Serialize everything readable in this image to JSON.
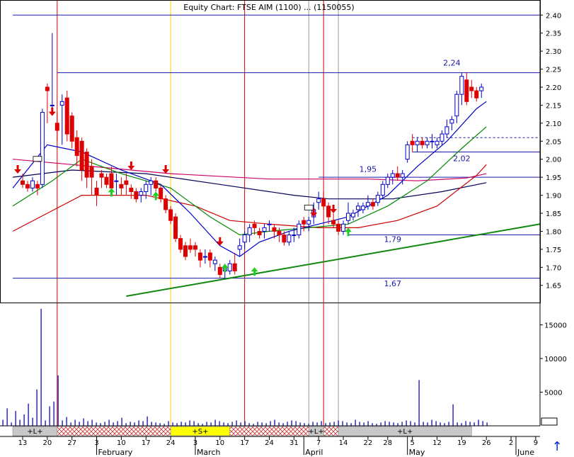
{
  "header": {
    "title": "Equity Chart: FTSE AIM (1100) ... (1150055)"
  },
  "chart_data": {
    "type": "candlestick",
    "price_axis": {
      "ticks": [
        "2.40",
        "2.35",
        "2.30",
        "2.25",
        "2.20",
        "2.15",
        "2.10",
        "2.05",
        "2.00",
        "1.95",
        "1.90",
        "1.85",
        "1.80",
        "1.75",
        "1.70",
        "1.65"
      ],
      "ylim": [
        1.62,
        2.43
      ]
    },
    "volume_axis": {
      "ticks": [
        "15000",
        "10000",
        "5000"
      ],
      "ylim": [
        0,
        18000
      ]
    },
    "date_labels": [
      {
        "label": "13",
        "pos": 0
      },
      {
        "label": "20",
        "pos": 5
      },
      {
        "label": "27",
        "pos": 10
      },
      {
        "label": "3",
        "pos": 15
      },
      {
        "label": "10",
        "pos": 20
      },
      {
        "label": "17",
        "pos": 25
      },
      {
        "label": "24",
        "pos": 30
      },
      {
        "label": "3",
        "pos": 35
      },
      {
        "label": "10",
        "pos": 40
      },
      {
        "label": "17",
        "pos": 45
      },
      {
        "label": "24",
        "pos": 50
      },
      {
        "label": "31",
        "pos": 55
      },
      {
        "label": "7",
        "pos": 60
      },
      {
        "label": "14",
        "pos": 65
      },
      {
        "label": "22",
        "pos": 70
      },
      {
        "label": "28",
        "pos": 74
      },
      {
        "label": "5",
        "pos": 79
      },
      {
        "label": "12",
        "pos": 84
      },
      {
        "label": "19",
        "pos": 89
      },
      {
        "label": "26",
        "pos": 94
      },
      {
        "label": "2",
        "pos": 99
      },
      {
        "label": "9",
        "pos": 104
      }
    ],
    "month_labels": [
      {
        "label": "February",
        "pos": 15
      },
      {
        "label": "March",
        "pos": 35
      },
      {
        "label": "April",
        "pos": 57
      },
      {
        "label": "May",
        "pos": 78
      },
      {
        "label": "June",
        "pos": 100
      }
    ],
    "annotations": [
      {
        "text": "2,24",
        "price": 2.26,
        "pos": 87
      },
      {
        "text": "2,02",
        "price": 1.995,
        "pos": 89
      },
      {
        "text": "1,95",
        "price": 1.965,
        "pos": 70
      },
      {
        "text": "1,79",
        "price": 1.77,
        "pos": 75
      },
      {
        "text": "1,67",
        "price": 1.648,
        "pos": 75
      }
    ],
    "horizontal_levels": [
      {
        "price": 2.4,
        "from": -2,
        "to": 107
      },
      {
        "price": 2.24,
        "from": 7,
        "to": 107
      },
      {
        "price": 2.02,
        "from": 79,
        "to": 107
      },
      {
        "price": 1.95,
        "from": 60,
        "to": 107
      },
      {
        "price": 1.79,
        "from": 66,
        "to": 107
      },
      {
        "price": 1.67,
        "from": -2,
        "to": 107
      }
    ],
    "dashed_levels": [
      {
        "price": 2.06,
        "from": 79,
        "to": 107
      }
    ],
    "trendline": {
      "from": {
        "pos": 21,
        "price": 1.62
      },
      "to": {
        "pos": 108,
        "price": 1.82
      }
    },
    "vertical_markers": [
      {
        "pos": 7,
        "color": "#cc0000"
      },
      {
        "pos": 30,
        "color": "#ffd200"
      },
      {
        "pos": 45,
        "color": "#cc0000"
      },
      {
        "pos": 58,
        "color": "#999999"
      },
      {
        "pos": 61,
        "color": "#cc0000"
      },
      {
        "pos": 64,
        "color": "#999999"
      }
    ],
    "signal_bar": [
      {
        "label": "+L+",
        "from": -2,
        "to": 7,
        "style": "grey"
      },
      {
        "label": "",
        "from": 7,
        "to": 30,
        "style": "hatch"
      },
      {
        "label": "+S+",
        "from": 30,
        "to": 42,
        "style": "yellow"
      },
      {
        "label": "",
        "from": 42,
        "to": 58,
        "style": "hatch"
      },
      {
        "label": "+L+",
        "from": 58,
        "to": 61,
        "style": "grey"
      },
      {
        "label": "",
        "from": 61,
        "to": 64,
        "style": "hatch"
      },
      {
        "label": "+L+",
        "from": 64,
        "to": 91,
        "style": "grey"
      }
    ],
    "candles": [
      [
        1.94,
        1.96,
        1.92,
        1.93
      ],
      [
        1.93,
        1.94,
        1.91,
        1.92
      ],
      [
        1.92,
        1.95,
        1.91,
        1.94
      ],
      [
        1.93,
        1.94,
        1.9,
        1.92
      ],
      [
        1.93,
        2.14,
        1.92,
        2.13
      ],
      [
        2.2,
        2.21,
        2.1,
        2.19
      ],
      [
        2.15,
        2.35,
        2.13,
        2.15
      ],
      [
        2.1,
        2.13,
        2.05,
        2.08
      ],
      [
        2.15,
        2.18,
        2.04,
        2.16
      ],
      [
        2.17,
        2.19,
        2.05,
        2.07
      ],
      [
        2.12,
        2.13,
        2.03,
        2.05
      ],
      [
        2.06,
        2.08,
        1.98,
        2.01
      ],
      [
        2.05,
        2.06,
        1.94,
        1.97
      ],
      [
        2.02,
        2.03,
        1.92,
        1.95
      ],
      [
        1.98,
        2.0,
        1.9,
        1.95
      ],
      [
        1.92,
        1.94,
        1.87,
        1.9
      ],
      [
        1.96,
        1.97,
        1.92,
        1.95
      ],
      [
        1.95,
        1.96,
        1.92,
        1.93
      ],
      [
        1.96,
        1.98,
        1.91,
        1.92
      ],
      [
        1.94,
        1.96,
        1.9,
        1.94
      ],
      [
        1.93,
        1.95,
        1.9,
        1.92
      ],
      [
        1.94,
        1.96,
        1.9,
        1.93
      ],
      [
        1.92,
        1.93,
        1.89,
        1.91
      ],
      [
        1.91,
        1.92,
        1.88,
        1.89
      ],
      [
        1.9,
        1.92,
        1.88,
        1.91
      ],
      [
        1.91,
        1.94,
        1.89,
        1.93
      ],
      [
        1.93,
        1.95,
        1.9,
        1.94
      ],
      [
        1.94,
        1.95,
        1.91,
        1.92
      ],
      [
        1.92,
        1.93,
        1.88,
        1.89
      ],
      [
        1.89,
        1.9,
        1.85,
        1.86
      ],
      [
        1.86,
        1.87,
        1.82,
        1.83
      ],
      [
        1.84,
        1.85,
        1.77,
        1.78
      ],
      [
        1.78,
        1.79,
        1.74,
        1.75
      ],
      [
        1.76,
        1.77,
        1.72,
        1.73
      ],
      [
        1.76,
        1.78,
        1.74,
        1.75
      ],
      [
        1.76,
        1.77,
        1.73,
        1.75
      ],
      [
        1.74,
        1.75,
        1.7,
        1.72
      ],
      [
        1.73,
        1.75,
        1.71,
        1.73
      ],
      [
        1.74,
        1.75,
        1.7,
        1.72
      ],
      [
        1.71,
        1.73,
        1.69,
        1.72
      ],
      [
        1.7,
        1.71,
        1.67,
        1.68
      ],
      [
        1.69,
        1.71,
        1.67,
        1.7
      ],
      [
        1.69,
        1.72,
        1.68,
        1.71
      ],
      [
        1.71,
        1.74,
        1.68,
        1.69
      ],
      [
        1.75,
        1.78,
        1.73,
        1.76
      ],
      [
        1.77,
        1.8,
        1.75,
        1.79
      ],
      [
        1.79,
        1.82,
        1.77,
        1.81
      ],
      [
        1.82,
        1.83,
        1.79,
        1.81
      ],
      [
        1.8,
        1.81,
        1.78,
        1.79
      ],
      [
        1.8,
        1.82,
        1.78,
        1.81
      ],
      [
        1.82,
        1.83,
        1.8,
        1.82
      ],
      [
        1.81,
        1.82,
        1.78,
        1.8
      ],
      [
        1.8,
        1.81,
        1.77,
        1.79
      ],
      [
        1.79,
        1.8,
        1.76,
        1.77
      ],
      [
        1.77,
        1.8,
        1.76,
        1.79
      ],
      [
        1.79,
        1.81,
        1.77,
        1.79
      ],
      [
        1.79,
        1.83,
        1.78,
        1.82
      ],
      [
        1.83,
        1.84,
        1.8,
        1.82
      ],
      [
        1.82,
        1.84,
        1.8,
        1.83
      ],
      [
        1.84,
        1.88,
        1.82,
        1.86
      ],
      [
        1.88,
        1.91,
        1.86,
        1.89
      ],
      [
        1.89,
        1.91,
        1.86,
        1.87
      ],
      [
        1.87,
        1.88,
        1.82,
        1.84
      ],
      [
        1.83,
        1.85,
        1.81,
        1.82
      ],
      [
        1.82,
        1.83,
        1.79,
        1.8
      ],
      [
        1.8,
        1.83,
        1.79,
        1.82
      ],
      [
        1.83,
        1.88,
        1.82,
        1.85
      ],
      [
        1.84,
        1.86,
        1.83,
        1.85
      ],
      [
        1.86,
        1.88,
        1.84,
        1.87
      ],
      [
        1.86,
        1.88,
        1.85,
        1.87
      ],
      [
        1.87,
        1.9,
        1.86,
        1.88
      ],
      [
        1.88,
        1.89,
        1.86,
        1.87
      ],
      [
        1.88,
        1.91,
        1.87,
        1.9
      ],
      [
        1.9,
        1.94,
        1.89,
        1.93
      ],
      [
        1.93,
        1.96,
        1.92,
        1.95
      ],
      [
        1.95,
        1.97,
        1.93,
        1.96
      ],
      [
        1.96,
        1.98,
        1.94,
        1.95
      ],
      [
        1.95,
        1.97,
        1.93,
        1.96
      ],
      [
        2.0,
        2.05,
        1.99,
        2.04
      ],
      [
        2.05,
        2.07,
        2.02,
        2.04
      ],
      [
        2.04,
        2.06,
        2.02,
        2.05
      ],
      [
        2.05,
        2.06,
        2.03,
        2.04
      ],
      [
        2.04,
        2.06,
        2.03,
        2.05
      ],
      [
        2.05,
        2.07,
        2.03,
        2.05
      ],
      [
        2.04,
        2.06,
        2.03,
        2.05
      ],
      [
        2.05,
        2.08,
        2.04,
        2.07
      ],
      [
        2.07,
        2.11,
        2.06,
        2.09
      ],
      [
        2.1,
        2.12,
        2.08,
        2.11
      ],
      [
        2.12,
        2.19,
        2.1,
        2.18
      ],
      [
        2.18,
        2.24,
        2.15,
        2.23
      ],
      [
        2.22,
        2.24,
        2.15,
        2.16
      ],
      [
        2.2,
        2.22,
        2.17,
        2.19
      ],
      [
        2.19,
        2.2,
        2.16,
        2.17
      ],
      [
        2.19,
        2.21,
        2.17,
        2.2
      ]
    ],
    "volume": [
      900,
      2600,
      500,
      2200,
      900,
      1700,
      3300,
      1200,
      5400,
      17400,
      800,
      2900,
      3600,
      7500,
      800,
      1300,
      500,
      900,
      600,
      1100,
      700,
      900,
      500,
      400,
      600,
      900,
      500,
      700,
      1200,
      400,
      600,
      500,
      800,
      700,
      1400,
      600,
      500,
      400,
      300,
      700,
      500,
      400,
      600,
      500,
      800,
      700,
      400,
      300,
      600,
      500,
      900,
      700,
      500,
      400,
      600,
      800,
      500,
      700,
      400,
      300,
      600,
      500,
      400,
      700,
      900,
      500,
      400,
      600,
      800,
      700,
      500,
      400,
      300,
      600,
      500,
      700,
      400,
      500,
      600,
      800,
      700,
      500,
      400,
      900,
      600,
      500,
      700,
      400,
      300,
      500,
      700,
      600,
      500,
      400,
      600,
      800,
      700,
      500,
      6800,
      600,
      500,
      900,
      700,
      500,
      400,
      600,
      3200,
      500,
      400,
      700,
      600,
      500,
      900,
      700,
      500
    ],
    "moving_averages": [
      {
        "color": "#cc0066",
        "points": [
          [
            -2,
            2.0
          ],
          [
            10,
            1.985
          ],
          [
            30,
            1.96
          ],
          [
            50,
            1.945
          ],
          [
            60,
            1.945
          ],
          [
            70,
            1.945
          ],
          [
            80,
            1.94
          ],
          [
            90,
            1.948
          ],
          [
            94,
            1.96
          ]
        ]
      },
      {
        "color": "#000055",
        "points": [
          [
            -2,
            1.95
          ],
          [
            10,
            1.97
          ],
          [
            25,
            1.96
          ],
          [
            40,
            1.93
          ],
          [
            55,
            1.9
          ],
          [
            62,
            1.89
          ],
          [
            75,
            1.89
          ],
          [
            85,
            1.91
          ],
          [
            94,
            1.935
          ]
        ]
      },
      {
        "color": "#cc0000",
        "points": [
          [
            -2,
            1.8
          ],
          [
            5,
            1.85
          ],
          [
            12,
            1.9
          ],
          [
            25,
            1.9
          ],
          [
            35,
            1.87
          ],
          [
            42,
            1.83
          ],
          [
            50,
            1.82
          ],
          [
            60,
            1.81
          ],
          [
            68,
            1.81
          ],
          [
            76,
            1.83
          ],
          [
            84,
            1.87
          ],
          [
            92,
            1.955
          ],
          [
            94,
            1.985
          ]
        ]
      },
      {
        "color": "#008800",
        "points": [
          [
            -2,
            1.87
          ],
          [
            6,
            1.94
          ],
          [
            12,
            2.0
          ],
          [
            20,
            1.96
          ],
          [
            30,
            1.92
          ],
          [
            38,
            1.84
          ],
          [
            44,
            1.79
          ],
          [
            50,
            1.8
          ],
          [
            58,
            1.81
          ],
          [
            66,
            1.82
          ],
          [
            74,
            1.87
          ],
          [
            82,
            1.94
          ],
          [
            89,
            2.03
          ],
          [
            94,
            2.09
          ]
        ]
      },
      {
        "color": "#0000cc",
        "points": [
          [
            -2,
            1.92
          ],
          [
            5,
            2.04
          ],
          [
            12,
            2.02
          ],
          [
            20,
            1.97
          ],
          [
            28,
            1.93
          ],
          [
            34,
            1.85
          ],
          [
            40,
            1.76
          ],
          [
            44,
            1.73
          ],
          [
            48,
            1.77
          ],
          [
            54,
            1.8
          ],
          [
            60,
            1.82
          ],
          [
            66,
            1.84
          ],
          [
            74,
            1.9
          ],
          [
            80,
            1.98
          ],
          [
            86,
            2.05
          ],
          [
            92,
            2.14
          ],
          [
            94,
            2.16
          ]
        ]
      }
    ],
    "signal_arrows": [
      {
        "pos": -1,
        "price": 1.96,
        "dir": "down"
      },
      {
        "pos": 6,
        "price": 2.12,
        "dir": "down"
      },
      {
        "pos": 18,
        "price": 1.92,
        "dir": "up"
      },
      {
        "pos": 22,
        "price": 1.97,
        "dir": "down"
      },
      {
        "pos": 27,
        "price": 1.91,
        "dir": "up"
      },
      {
        "pos": 29,
        "price": 1.96,
        "dir": "down"
      },
      {
        "pos": 40,
        "price": 1.76,
        "dir": "down"
      },
      {
        "pos": 41,
        "price": 1.71,
        "dir": "up"
      },
      {
        "pos": 47,
        "price": 1.7,
        "dir": "up"
      },
      {
        "pos": 59,
        "price": 1.84,
        "dir": "down"
      },
      {
        "pos": 63,
        "price": 1.85,
        "dir": "down"
      },
      {
        "pos": 66,
        "price": 1.81,
        "dir": "up"
      }
    ],
    "ex_markers": [
      {
        "pos": 3,
        "price": 2.0
      },
      {
        "pos": 58,
        "price": 1.865
      }
    ]
  },
  "controls": {
    "scroll_up_icon": "↑"
  }
}
